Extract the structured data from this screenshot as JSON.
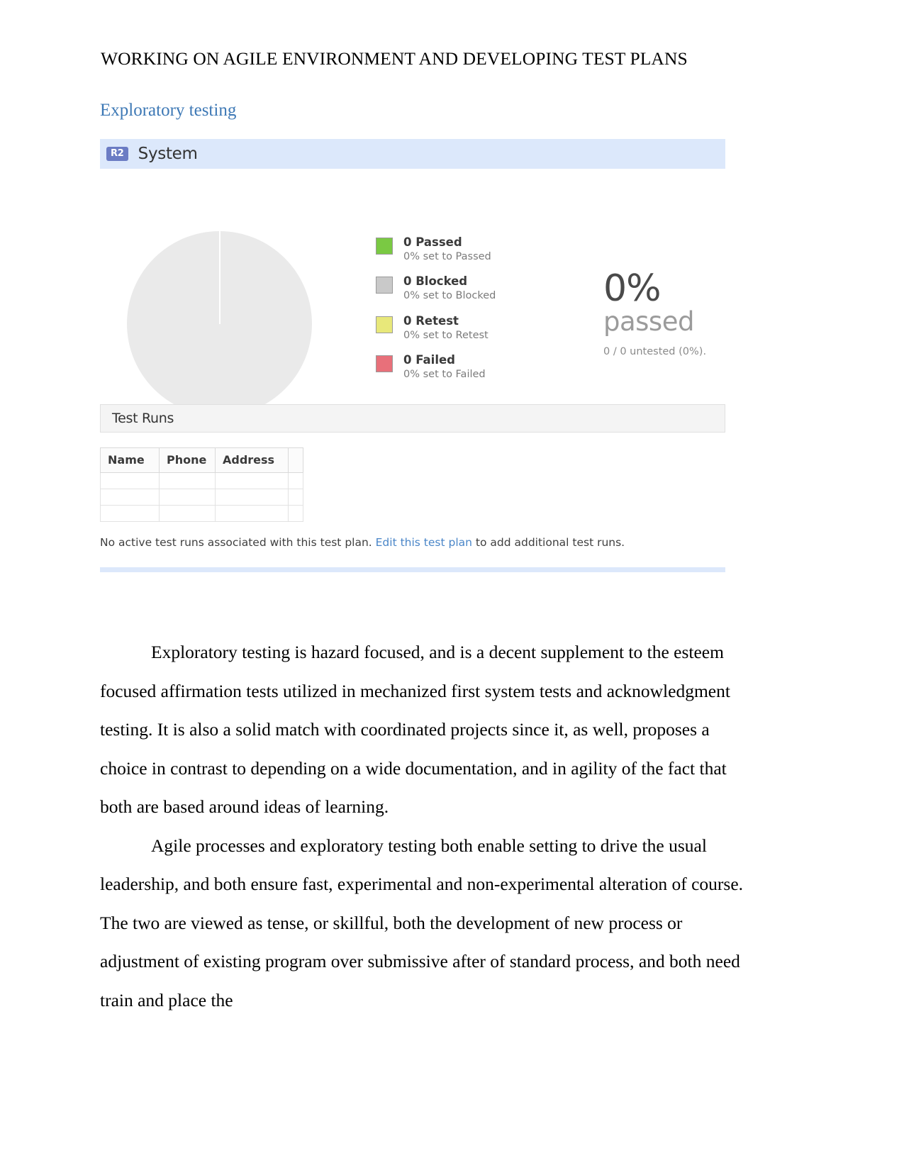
{
  "document": {
    "running_head": "WORKING ON AGILE ENVIRONMENT AND DEVELOPING TEST PLANS",
    "section_heading": "Exploratory testing"
  },
  "widget": {
    "badge": "R2",
    "title": "System",
    "colors": {
      "title_bar": "#dce8fb",
      "badge_bg": "#6b7cc4",
      "passed": "#7ac943",
      "blocked": "#c9c9c9",
      "retest": "#e8e87a",
      "failed": "#e8707a",
      "link": "#4a86c8"
    },
    "summary": {
      "legend": [
        {
          "label": "0 Passed",
          "sub": "0% set to Passed",
          "color": "#7ac943"
        },
        {
          "label": "0 Blocked",
          "sub": "0% set to Blocked",
          "color": "#c9c9c9"
        },
        {
          "label": "0 Retest",
          "sub": "0% set to Retest",
          "color": "#e8e87a"
        },
        {
          "label": "0 Failed",
          "sub": "0% set to Failed",
          "color": "#e8707a"
        }
      ],
      "percent_value": "0%",
      "percent_word": "passed",
      "untested": "0 / 0 untested (0%)."
    },
    "test_runs": {
      "title": "Test Runs",
      "columns": [
        "Name",
        "Phone",
        "Address",
        ""
      ],
      "rows": [
        [
          "",
          "",
          "",
          ""
        ],
        [
          "",
          "",
          "",
          ""
        ],
        [
          "",
          "",
          "",
          ""
        ]
      ],
      "note_before_link": "No active test runs associated with this test plan. ",
      "note_link": "Edit this test plan",
      "note_after_link": " to add additional test runs."
    }
  },
  "chart_data": {
    "type": "pie",
    "title": "System test plan results",
    "categories": [
      "Passed",
      "Blocked",
      "Retest",
      "Failed",
      "Untested"
    ],
    "values": [
      0,
      0,
      0,
      0,
      0
    ],
    "percentages": [
      0,
      0,
      0,
      0,
      0
    ],
    "colors": [
      "#7ac943",
      "#c9c9c9",
      "#e8e87a",
      "#e8707a",
      "#eaeaea"
    ],
    "legend_position": "right",
    "annotation": "0% passed — 0 / 0 untested (0%).",
    "notes": "All counts are zero; pie renders as a single empty (untested) gray disc with a white split line at 12 o'clock."
  },
  "body": {
    "paragraph_1": "Exploratory testing is hazard focused, and is a decent supplement to the esteem focused affirmation tests utilized in mechanized first system tests and acknowledgment testing. It is also a solid match with coordinated projects since it, as well, proposes a choice in contrast to depending on a wide documentation, and in agility of the fact that both are based around ideas of learning.",
    "paragraph_2": "Agile processes and exploratory testing both enable setting to drive the usual leadership, and both ensure fast, experimental and non-experimental alteration of course. The two are viewed as tense, or skillful, both the development of new process or adjustment of existing program over submissive after of standard process, and both need train and place the"
  }
}
